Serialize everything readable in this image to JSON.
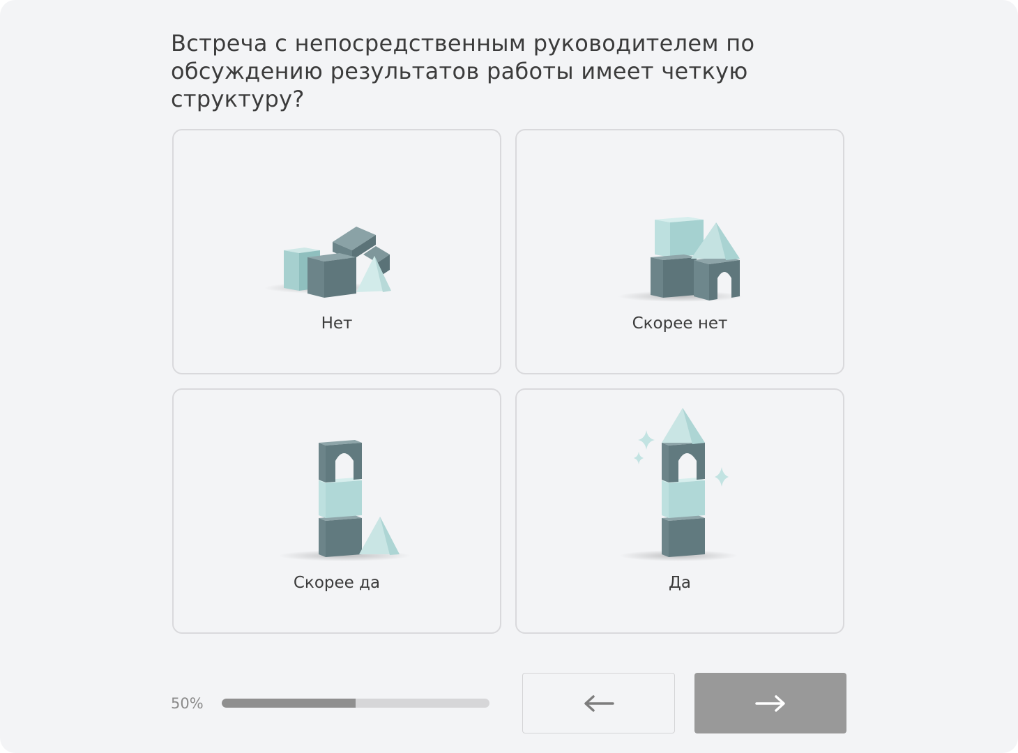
{
  "question": "Встреча с непосредственным руководителем по обсуждению результатов работы имеет четкую структуру?",
  "options": [
    {
      "label": "Нет",
      "image": "scattered-blocks-image"
    },
    {
      "label": "Скорее нет",
      "image": "low-castle-blocks-image"
    },
    {
      "label": "Скорее да",
      "image": "tower-blocks-image"
    },
    {
      "label": "Да",
      "image": "tall-tower-sparkles-image"
    }
  ],
  "progress": {
    "label": "50%",
    "value": 0.5
  },
  "navigation": {
    "back_icon": "arrow-left-icon",
    "next_icon": "arrow-right-icon"
  },
  "colors": {
    "background": "#f3f4f6",
    "block_dark": "#6e878c",
    "block_light": "#b7dcdb",
    "next_button": "#999999",
    "progress_fill": "#8f8f8f"
  }
}
